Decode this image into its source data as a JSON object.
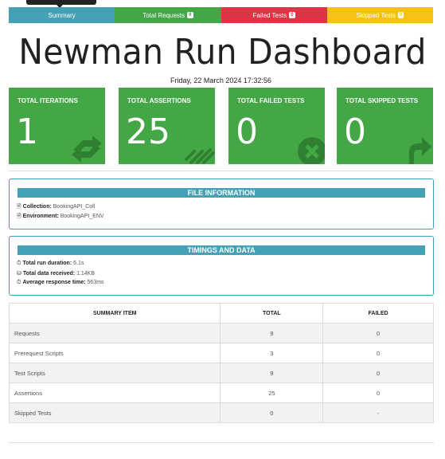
{
  "tabs": [
    {
      "label": "Summary",
      "badge": ""
    },
    {
      "label": "Total Requests",
      "badge": "9"
    },
    {
      "label": "Failed Tests",
      "badge": "0"
    },
    {
      "label": "Skipped Tests",
      "badge": "0"
    }
  ],
  "page_title": "Newman Run Dashboard",
  "run_datetime": "Friday, 22 March 2024 17:32:56",
  "cards": [
    {
      "label": "TOTAL ITERATIONS",
      "value": "1",
      "icon": "sync-icon"
    },
    {
      "label": "TOTAL ASSERTIONS",
      "value": "25",
      "icon": "list-icon"
    },
    {
      "label": "TOTAL FAILED TESTS",
      "value": "0",
      "icon": "times-circle-icon"
    },
    {
      "label": "TOTAL SKIPPED TESTS",
      "value": "0",
      "icon": "share-arrow-icon"
    }
  ],
  "file_info": {
    "heading": "FILE INFORMATION",
    "collection_label": "Collection:",
    "collection_value": "BookingAPI_Coll",
    "environment_label": "Environment:",
    "environment_value": "BookingAPI_ENV"
  },
  "timings": {
    "heading": "TIMINGS AND DATA",
    "duration_label": "Total run duration:",
    "duration_value": "6.1s",
    "data_label": "Total data received:",
    "data_value": "1.14KB",
    "response_label": "Average response time:",
    "response_value": "563ms"
  },
  "summary_table": {
    "headers": [
      "SUMMARY ITEM",
      "TOTAL",
      "FAILED"
    ],
    "rows": [
      {
        "item": "Requests",
        "total": "9",
        "failed": "0"
      },
      {
        "item": "Prerequest Scripts",
        "total": "3",
        "failed": "0"
      },
      {
        "item": "Test Scripts",
        "total": "9",
        "failed": "0"
      },
      {
        "item": "Assertions",
        "total": "25",
        "failed": "0"
      },
      {
        "item": "Skipped Tests",
        "total": "0",
        "failed": "-"
      }
    ]
  },
  "colors": {
    "summary_tab": "#45a1b5",
    "success": "#44a746",
    "danger": "#dc3545",
    "warning": "#f5c116"
  }
}
